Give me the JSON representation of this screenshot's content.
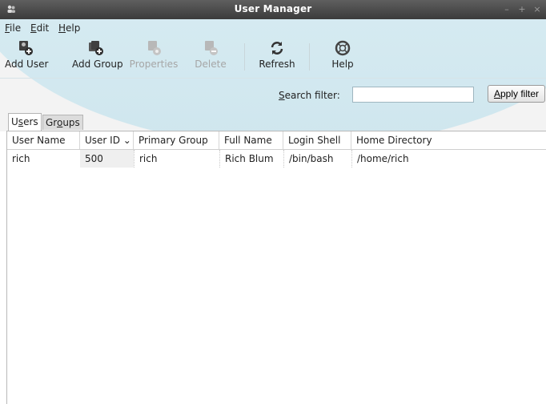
{
  "window": {
    "title": "User Manager",
    "app_icon": "people-icon",
    "controls": [
      "minimize-icon",
      "maximize-icon",
      "close-icon"
    ]
  },
  "menubar": {
    "items": [
      {
        "accel": "F",
        "rest": "ile"
      },
      {
        "accel": "E",
        "rest": "dit"
      },
      {
        "accel": "H",
        "rest": "elp"
      }
    ]
  },
  "toolbar": {
    "add_user": "Add User",
    "add_group": "Add Group",
    "properties": "Properties",
    "delete": "Delete",
    "refresh": "Refresh",
    "help": "Help"
  },
  "search": {
    "label_accel": "S",
    "label_rest": "earch filter:",
    "value": "",
    "apply_accel": "A",
    "apply_rest": "pply filter"
  },
  "tabs": [
    {
      "pre": "U",
      "accel": "s",
      "post": "ers"
    },
    {
      "pre": "Gr",
      "accel": "o",
      "post": "ups"
    }
  ],
  "table": {
    "columns": [
      "User Name",
      "User ID ⌄",
      "Primary Group",
      "Full Name",
      "Login Shell",
      "Home Directory"
    ],
    "rows": [
      [
        "rich",
        "500",
        "rich",
        "Rich Blum",
        "/bin/bash",
        "/home/rich"
      ]
    ]
  },
  "colors": {
    "titlebar": "#3b3b3b",
    "sky": "#dff1f6",
    "chrome": "#f3f3f3"
  }
}
